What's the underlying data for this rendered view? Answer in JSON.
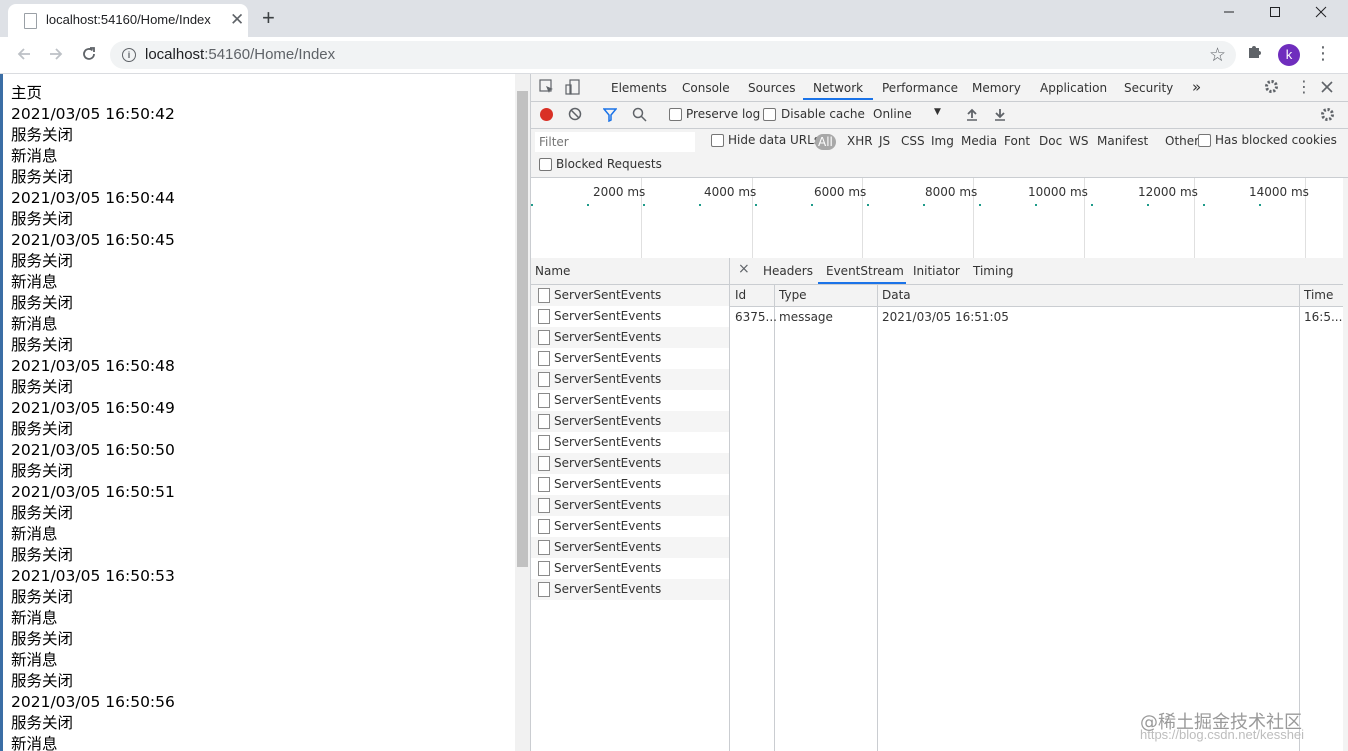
{
  "browser": {
    "tab_title": "localhost:54160/Home/Index",
    "tab_close": "✕",
    "new_tab": "+",
    "url_host": "localhost",
    "url_rest": ":54160/Home/Index"
  },
  "page": {
    "lines": [
      "主页",
      "2021/03/05 16:50:42",
      "服务关闭",
      "新消息",
      "服务关闭",
      "2021/03/05 16:50:44",
      "服务关闭",
      "2021/03/05 16:50:45",
      "服务关闭",
      "新消息",
      "服务关闭",
      "新消息",
      "服务关闭",
      "2021/03/05 16:50:48",
      "服务关闭",
      "2021/03/05 16:50:49",
      "服务关闭",
      "2021/03/05 16:50:50",
      "服务关闭",
      "2021/03/05 16:50:51",
      "服务关闭",
      "新消息",
      "服务关闭",
      "2021/03/05 16:50:53",
      "服务关闭",
      "新消息",
      "服务关闭",
      "新消息",
      "服务关闭",
      "2021/03/05 16:50:56",
      "服务关闭",
      "新消息"
    ]
  },
  "devtools": {
    "tabs": [
      "Elements",
      "Console",
      "Sources",
      "Network",
      "Performance",
      "Memory",
      "Application",
      "Security"
    ],
    "more_tabs": "»",
    "toolbar": {
      "preserve_log": "Preserve log",
      "disable_cache": "Disable cache",
      "throttle": "Online"
    },
    "filter": {
      "placeholder": "Filter",
      "hide_data_urls": "Hide data URLs",
      "types": [
        "All",
        "XHR",
        "JS",
        "CSS",
        "Img",
        "Media",
        "Font",
        "Doc",
        "WS",
        "Manifest",
        "Other"
      ],
      "has_blocked_cookies": "Has blocked cookies",
      "blocked_requests": "Blocked Requests"
    },
    "timeline_labels": [
      "2000 ms",
      "4000 ms",
      "6000 ms",
      "8000 ms",
      "10000 ms",
      "12000 ms",
      "14000 ms"
    ],
    "name_header": "Name",
    "requests": [
      "ServerSentEvents",
      "ServerSentEvents",
      "ServerSentEvents",
      "ServerSentEvents",
      "ServerSentEvents",
      "ServerSentEvents",
      "ServerSentEvents",
      "ServerSentEvents",
      "ServerSentEvents",
      "ServerSentEvents",
      "ServerSentEvents",
      "ServerSentEvents",
      "ServerSentEvents",
      "ServerSentEvents",
      "ServerSentEvents"
    ],
    "detail_tabs": [
      "Headers",
      "EventStream",
      "Initiator",
      "Timing"
    ],
    "eventstream": {
      "headers": [
        "Id",
        "Type",
        "Data",
        "Time"
      ],
      "row": {
        "id": "6375...",
        "type": "message",
        "data": "2021/03/05 16:51:05",
        "time": "16:5..."
      }
    }
  },
  "watermark": {
    "text": "@稀土掘金技术社区",
    "url": "https://blog.csdn.net/kesshei"
  }
}
